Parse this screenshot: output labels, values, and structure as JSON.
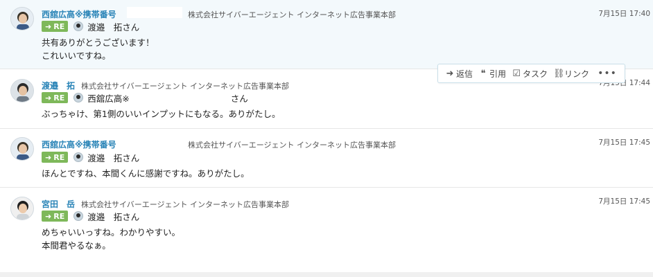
{
  "messages": [
    {
      "name": "西舘広高※携帯番号",
      "org": "株式会社サイバーエージェント インターネット広告事業本部",
      "time": "7月15日 17:40",
      "re_label": "RE",
      "re_to": "渡邉　拓さん",
      "body": [
        "共有ありがとうございます！",
        "これいいですね。"
      ]
    },
    {
      "name": "渡邉　拓",
      "org": "株式会社サイバーエージェント インターネット広告事業本部",
      "time": "7月15日 17:44",
      "re_label": "RE",
      "re_to": "西舘広高※",
      "re_to_suffix": "さん",
      "body": [
        "ぶっちゃけ、第1側のいいインプットにもなる。ありがたし。"
      ]
    },
    {
      "name": "西舘広高※携帯番号",
      "org": "株式会社サイバーエージェント インターネット広告事業本部",
      "time": "7月15日 17:45",
      "re_label": "RE",
      "re_to": "渡邉　拓さん",
      "body": [
        "ほんとですね、本間くんに感謝ですね。ありがたし。"
      ]
    },
    {
      "name": "宮田　岳",
      "org": "株式会社サイバーエージェント インターネット広告事業本部",
      "time": "7月15日 17:45",
      "re_label": "RE",
      "re_to": "渡邉　拓さん",
      "body": [
        "めちゃいいっすね。わかりやすい。",
        "本間君やるなぁ。"
      ]
    }
  ],
  "actions": {
    "reply": "返信",
    "quote": "引用",
    "task": "タスク",
    "link": "リンク",
    "more": "•••"
  },
  "colors": {
    "name": "#2a84b7",
    "re_badge": "#7eb85a",
    "hover_bg": "#f3f9fc"
  }
}
